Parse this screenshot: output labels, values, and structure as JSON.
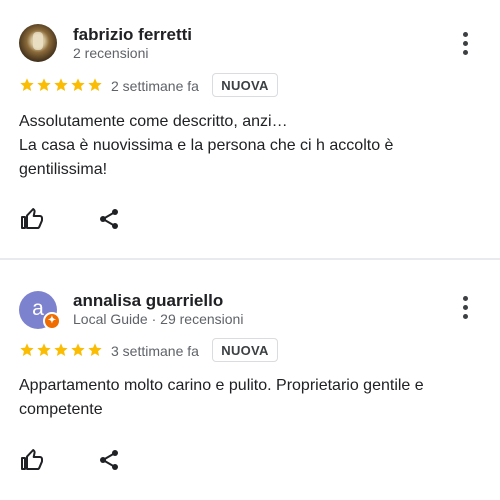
{
  "reviews": [
    {
      "author": "fabrizio ferretti",
      "meta": "2 recensioni",
      "rating": 5,
      "age": "2 settimane fa",
      "badge": "NUOVA",
      "text": "Assolutamente come descritto, anzi…\nLa casa è nuovissima e la persona che ci h accolto è gentilissima!"
    },
    {
      "author": "annalisa guarriello",
      "avatar_letter": "a",
      "meta": "Local Guide · 29 recensioni",
      "rating": 5,
      "age": "3 settimane fa",
      "badge": "NUOVA",
      "text": "Appartamento molto carino e pulito. Proprietario gentile e competente"
    }
  ],
  "colors": {
    "star": "#fbbc04",
    "avatar_bg": "#7d82cf",
    "local_guide_badge": "#ef6c00"
  },
  "icons": [
    "more-vert-icon",
    "star-icon",
    "thumb-up-icon",
    "share-icon",
    "local-guide-icon"
  ]
}
